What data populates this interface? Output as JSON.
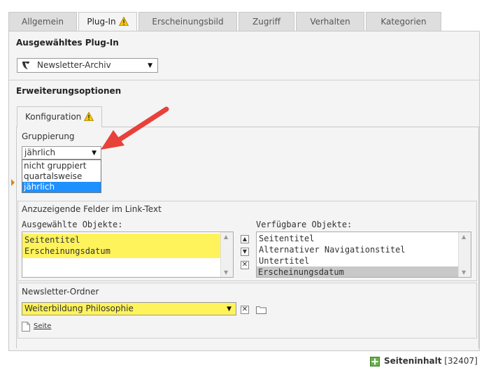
{
  "tabs": [
    {
      "label": "Allgemein",
      "active": false
    },
    {
      "label": "Plug-In",
      "active": true,
      "warning": true
    },
    {
      "label": "Erscheinungsbild",
      "active": false
    },
    {
      "label": "Zugriff",
      "active": false
    },
    {
      "label": "Verhalten",
      "active": false
    },
    {
      "label": "Kategorien",
      "active": false
    }
  ],
  "plugin": {
    "section_title": "Ausgewähltes Plug-In",
    "selected": "Newsletter-Archiv"
  },
  "extended": {
    "section_title": "Erweiterungsoptionen",
    "subtab_label": "Konfiguration"
  },
  "grouping": {
    "label": "Gruppierung",
    "selected": "jährlich",
    "options": [
      "nicht gruppiert",
      "quartalsweise",
      "jährlich"
    ],
    "highlighted_index": 2
  },
  "link_fields": {
    "legend": "Anzuzeigende Felder im Link-Text",
    "selected_label": "Ausgewählte Objekte:",
    "selected_items": [
      "Seitentitel",
      "Erscheinungsdatum"
    ],
    "available_label": "Verfügbare Objekte:",
    "available_items": [
      "Seitentitel",
      "Alternativer Navigationstitel",
      "Untertitel",
      "Erscheinungsdatum"
    ]
  },
  "newsletter_folder": {
    "label": "Newsletter-Ordner",
    "selected": "Weiterbildung Philosophie",
    "link_label": "Seite"
  },
  "footer": {
    "record_label": "Seiteninhalt",
    "record_id": "[32407]"
  },
  "colors": {
    "highlight_yellow": "#fff35c",
    "selection_blue": "#1e90ff",
    "arrow_red": "#e8413a",
    "warning_yellow": "#f7c600"
  }
}
